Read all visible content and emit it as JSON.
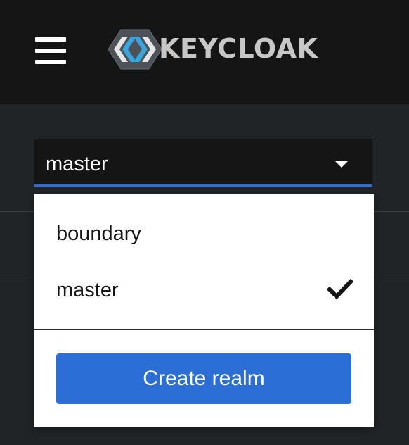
{
  "header": {
    "menu_icon": "hamburger-menu-icon",
    "logo_text": "KEYCLOAK",
    "logo_icon": "keycloak-logo-icon"
  },
  "realm_selector": {
    "selected": "master",
    "caret_icon": "caret-down-icon",
    "options": [
      {
        "label": "boundary",
        "selected": false
      },
      {
        "label": "master",
        "selected": true
      }
    ],
    "check_icon": "checkmark-icon",
    "create_button_label": "Create realm"
  },
  "colors": {
    "header_bg": "#151515",
    "page_bg": "#212427",
    "accent_blue": "#2b6fd6",
    "menu_bg": "#ffffff"
  }
}
